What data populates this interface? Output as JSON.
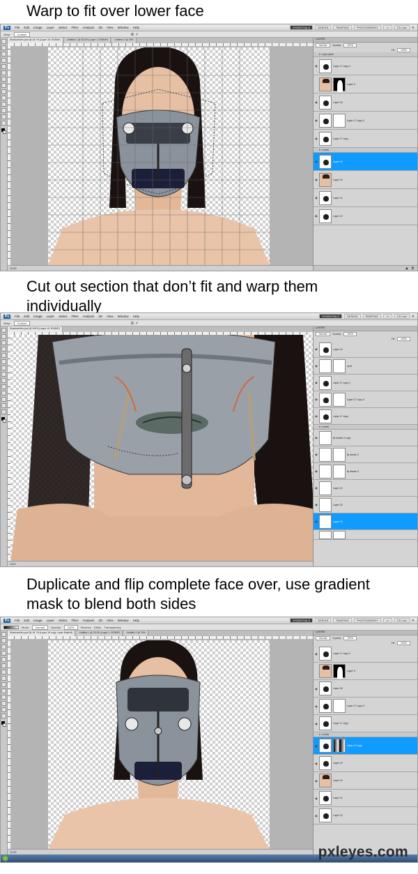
{
  "captions": {
    "step1": "Warp to fit over lower face",
    "step2": "Cut out section that don’t fit and warp them\nindividually",
    "step3": "Duplicate and flip complete face over, use gradient\nmask to blend both sides"
  },
  "watermark": "pxleyes.com",
  "colors": {
    "selection": "#0f9bff",
    "workspace": "#3a3a3a",
    "canvas_bg": "#b4b4b4",
    "skin": "#e7c0a4",
    "hair": "#1a1210"
  },
  "icons": [
    "eye-icon",
    "layer-group-icon",
    "chevron-down-icon",
    "close-icon",
    "trash-icon",
    "new-layer-icon",
    "start-orb-icon"
  ],
  "screens": [
    {
      "menu": [
        "File",
        "Edit",
        "Image",
        "Layer",
        "Select",
        "Filter",
        "Analysis",
        "3D",
        "View",
        "Window",
        "Help"
      ],
      "workspaces": [
        "ESSENTIALS",
        "DESIGN",
        "PAINTING",
        "PHOTOGRAPHY",
        ">>",
        "CS Live"
      ],
      "active_workspace": "ESSENTIALS",
      "options": {
        "warp_label": "Warp:",
        "warp_value": "Custom"
      },
      "zoom": "16.6%",
      "tabs": [
        "ShadowsVec.psd @ 16.7% (Layer 19, RGB/8*)",
        "Untitled-1 @ 33.3% (Layer 1, RGB/8*)",
        "Untitled-2 @ 25%"
      ],
      "panel": {
        "title": "LAYERS",
        "blend_mode": "Normal",
        "opacity_label": "Opacity:",
        "opacity": "100%",
        "fill_label": "Fill:",
        "fill": "100%"
      },
      "layers": [
        {
          "name": "eye parts",
          "kind": "group"
        },
        {
          "name": "Layer 17 copy 2",
          "kind": "layer"
        },
        {
          "name": "Layer 9",
          "kind": "face-mask"
        },
        {
          "name": "Layer 18",
          "kind": "layer"
        },
        {
          "name": "Layer 17 copy 3",
          "kind": "white-mask"
        },
        {
          "name": "Layer 17 copy",
          "kind": "layer"
        },
        {
          "name": "extra",
          "kind": "group"
        },
        {
          "name": "Layer 19",
          "kind": "selected"
        },
        {
          "name": "Layer 15",
          "kind": "face"
        },
        {
          "name": "Layer 14",
          "kind": "layer"
        },
        {
          "name": "Layer 13",
          "kind": "layer"
        }
      ]
    },
    {
      "menu": [
        "File",
        "Edit",
        "Image",
        "Layer",
        "Select",
        "Filter",
        "Analysis",
        "3D",
        "View",
        "Window",
        "Help"
      ],
      "workspaces": [
        "ESSENTIALS",
        "DESIGN",
        "PAINTING",
        ">>",
        "CS Live"
      ],
      "active_workspace": "ESSENTIALS",
      "options": {
        "warp_label": "Warp:",
        "warp_value": "Custom"
      },
      "zoom": "100%",
      "tabs": [
        "ShadowsVec.psd @ 100% (Layer 19, RGB/8*)"
      ],
      "panel": {
        "title": "LAYERS",
        "blend_mode": "Normal",
        "opacity_label": "Opacity:",
        "opacity": "100%",
        "fill_label": "Fill:",
        "fill": "100%"
      },
      "layers": [
        {
          "name": "Layer 19",
          "kind": "layer"
        },
        {
          "name": "eyes",
          "kind": "face-mask"
        },
        {
          "name": "Layer 17 copy 2",
          "kind": "layer"
        },
        {
          "name": "Layer 17 copy 3",
          "kind": "white-mask"
        },
        {
          "name": "Layer 17 copy",
          "kind": "layer"
        },
        {
          "name": "extra",
          "kind": "group"
        },
        {
          "name": "lip shade 4 copy",
          "kind": "layer"
        },
        {
          "name": "lip shade 4",
          "kind": "white-mask"
        },
        {
          "name": "lip shade 3",
          "kind": "white-mask"
        },
        {
          "name": "Layer 21",
          "kind": "layer"
        },
        {
          "name": "Layer 20",
          "kind": "layer"
        },
        {
          "name": "Layer 19",
          "kind": "selected"
        },
        {
          "name": "",
          "kind": "white-mask"
        }
      ]
    },
    {
      "menu": [
        "File",
        "Edit",
        "Image",
        "Layer",
        "Select",
        "Filter",
        "Analysis",
        "3D",
        "View",
        "Window",
        "Help"
      ],
      "workspaces": [
        "ESSENTIALS",
        "DESIGN",
        "PAINTING",
        "PHOTOGRAPHY",
        ">>",
        "CS Live"
      ],
      "active_workspace": "ESSENTIALS",
      "options": {
        "warp_label": "Mode:",
        "warp_value": "Normal",
        "opacity_label": "Opacity:",
        "opacity": "100%",
        "extra": [
          "Reverse",
          "Dither",
          "Transparency"
        ]
      },
      "zoom": "16.6%",
      "tabs": [
        "ShadowsVec.psd @ 16.7% (Layer 19 copy, Layer Mask/8)",
        "Untitled-1 @ 33.3% (Layer 1, RGB/8*)",
        "Untitled-2 @ 25%"
      ],
      "panel": {
        "title": "LAYERS",
        "blend_mode": "Normal",
        "opacity_label": "Opacity:",
        "opacity": "100%",
        "fill_label": "Fill:",
        "fill": "100%"
      },
      "layers": [
        {
          "name": "Layer 17 copy 2",
          "kind": "layer"
        },
        {
          "name": "Layer 9",
          "kind": "face-mask"
        },
        {
          "name": "Layer 18",
          "kind": "layer"
        },
        {
          "name": "Layer 17 copy 3",
          "kind": "white-mask"
        },
        {
          "name": "Layer 17 copy",
          "kind": "layer"
        },
        {
          "name": "extra",
          "kind": "group"
        },
        {
          "name": "Layer 19 copy",
          "kind": "selected-grad"
        },
        {
          "name": "Layer 19",
          "kind": "layer"
        },
        {
          "name": "Layer 15",
          "kind": "face"
        },
        {
          "name": "Layer 14",
          "kind": "layer"
        },
        {
          "name": "Layer 13",
          "kind": "layer"
        }
      ]
    }
  ]
}
